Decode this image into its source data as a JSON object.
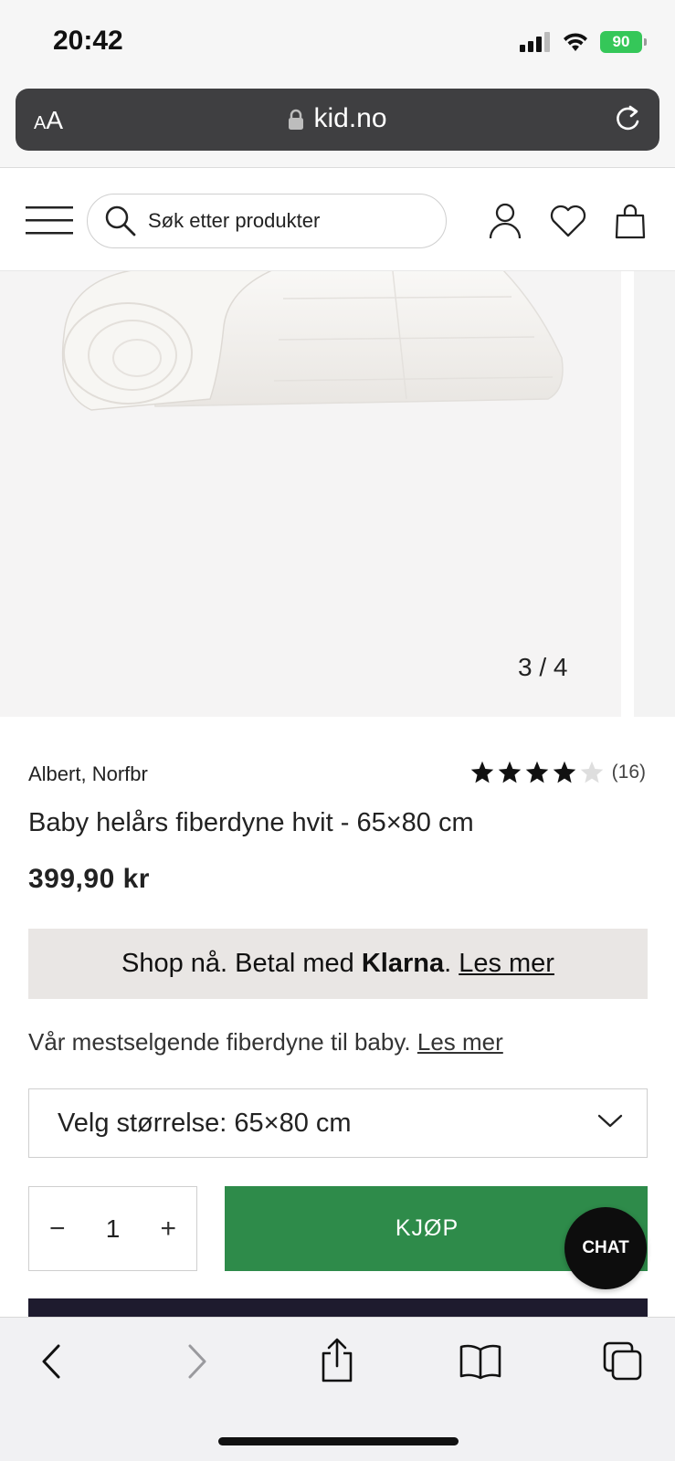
{
  "status_bar": {
    "time": "20:42",
    "battery": "90"
  },
  "browser": {
    "text_size_label_small": "A",
    "text_size_label_large": "A",
    "url": "kid.no"
  },
  "header": {
    "search_placeholder": "Søk etter produkter"
  },
  "gallery": {
    "counter": "3 / 4",
    "current": 3,
    "total": 4
  },
  "product": {
    "brand": "Albert, Norfbr",
    "rating": 4,
    "rating_max": 5,
    "review_count": "(16)",
    "title": "Baby helårs fiberdyne hvit - 65×80 cm",
    "price": "399,90 kr"
  },
  "klarna": {
    "prefix": "Shop nå. Betal med ",
    "brand": "Klarna",
    "dot": ". ",
    "link": "Les mer"
  },
  "description": {
    "text": "Vår mestselgende fiberdyne til baby. ",
    "link": "Les mer"
  },
  "size_select": {
    "label": "Velg størrelse: 65×80 cm"
  },
  "quantity": {
    "minus": "−",
    "value": "1",
    "plus": "+"
  },
  "buy_button": {
    "label": "KJØP"
  },
  "chat_button": {
    "label": "CHAT"
  },
  "colors": {
    "buy": "#2e8b4a",
    "klarna_bg": "#e9e6e4",
    "address_bar": "#3f3f41",
    "battery": "#35c759"
  }
}
